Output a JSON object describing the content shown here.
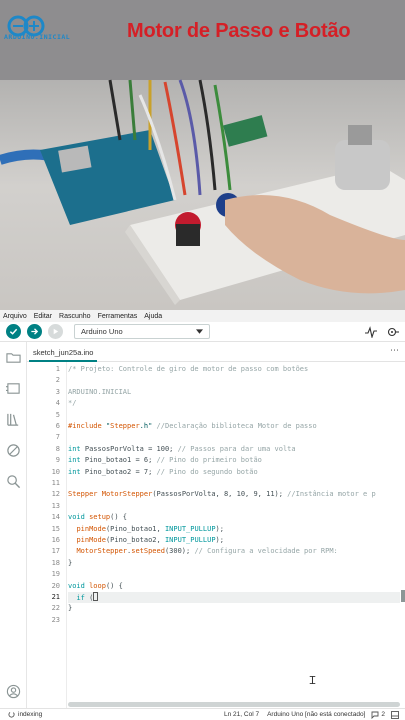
{
  "video": {
    "title": "Motor de Passo e Botão",
    "logo_text": "ARDUINO.INICIAL"
  },
  "menu": [
    "Arquivo",
    "Editar",
    "Rascunho",
    "Ferramentas",
    "Ajuda"
  ],
  "toolbar": {
    "verify_icon": "check-icon",
    "upload_icon": "arrow-right-icon",
    "debug_icon": "debug-icon",
    "board": "Arduino Uno",
    "serial_plotter_icon": "plotter-icon",
    "serial_monitor_icon": "monitor-icon"
  },
  "sidebar": [
    "folder-icon",
    "board-icon",
    "library-icon",
    "debug-icon",
    "search-icon",
    "account-icon"
  ],
  "tab": {
    "name": "sketch_jun25a.ino",
    "more": "⋯"
  },
  "editor": {
    "active_line": 21,
    "lines": [
      {
        "n": "1",
        "text": "/* Projeto: Controle de giro de motor de passo com botões"
      },
      {
        "n": "2",
        "text": ""
      },
      {
        "n": "3",
        "text": "ARDUINO.INICIAL"
      },
      {
        "n": "4",
        "text": "*/"
      },
      {
        "n": "5",
        "text": ""
      },
      {
        "n": "6",
        "text": "#include \"Stepper.h\" //Declaração biblioteca Motor de passo"
      },
      {
        "n": "7",
        "text": ""
      },
      {
        "n": "8",
        "text": "int PassosPorVolta = 100; // Passos para dar uma volta"
      },
      {
        "n": "9",
        "text": "int Pino_botao1 = 6; // Pino do primeiro botão"
      },
      {
        "n": "10",
        "text": "int Pino_botao2 = 7; // Pino do segundo botão"
      },
      {
        "n": "11",
        "text": ""
      },
      {
        "n": "12",
        "text": "Stepper MotorStepper(PassosPorVolta, 8, 10, 9, 11); //Instância motor e p"
      },
      {
        "n": "13",
        "text": ""
      },
      {
        "n": "14",
        "text": "void setup() {"
      },
      {
        "n": "15",
        "text": "  pinMode(Pino_botao1, INPUT_PULLUP);"
      },
      {
        "n": "16",
        "text": "  pinMode(Pino_botao2, INPUT_PULLUP);"
      },
      {
        "n": "17",
        "text": "  MotorStepper.setSpeed(300); // Configura a velocidade por RPM:"
      },
      {
        "n": "18",
        "text": "}"
      },
      {
        "n": "19",
        "text": ""
      },
      {
        "n": "20",
        "text": "void loop() {"
      },
      {
        "n": "21",
        "text": "  if ()"
      },
      {
        "n": "22",
        "text": "}"
      },
      {
        "n": "23",
        "text": ""
      }
    ]
  },
  "status": {
    "left": "indexing",
    "position": "Ln 21, Col 7",
    "board_status": "Arduino Uno [não está conectado]",
    "count": "2"
  }
}
